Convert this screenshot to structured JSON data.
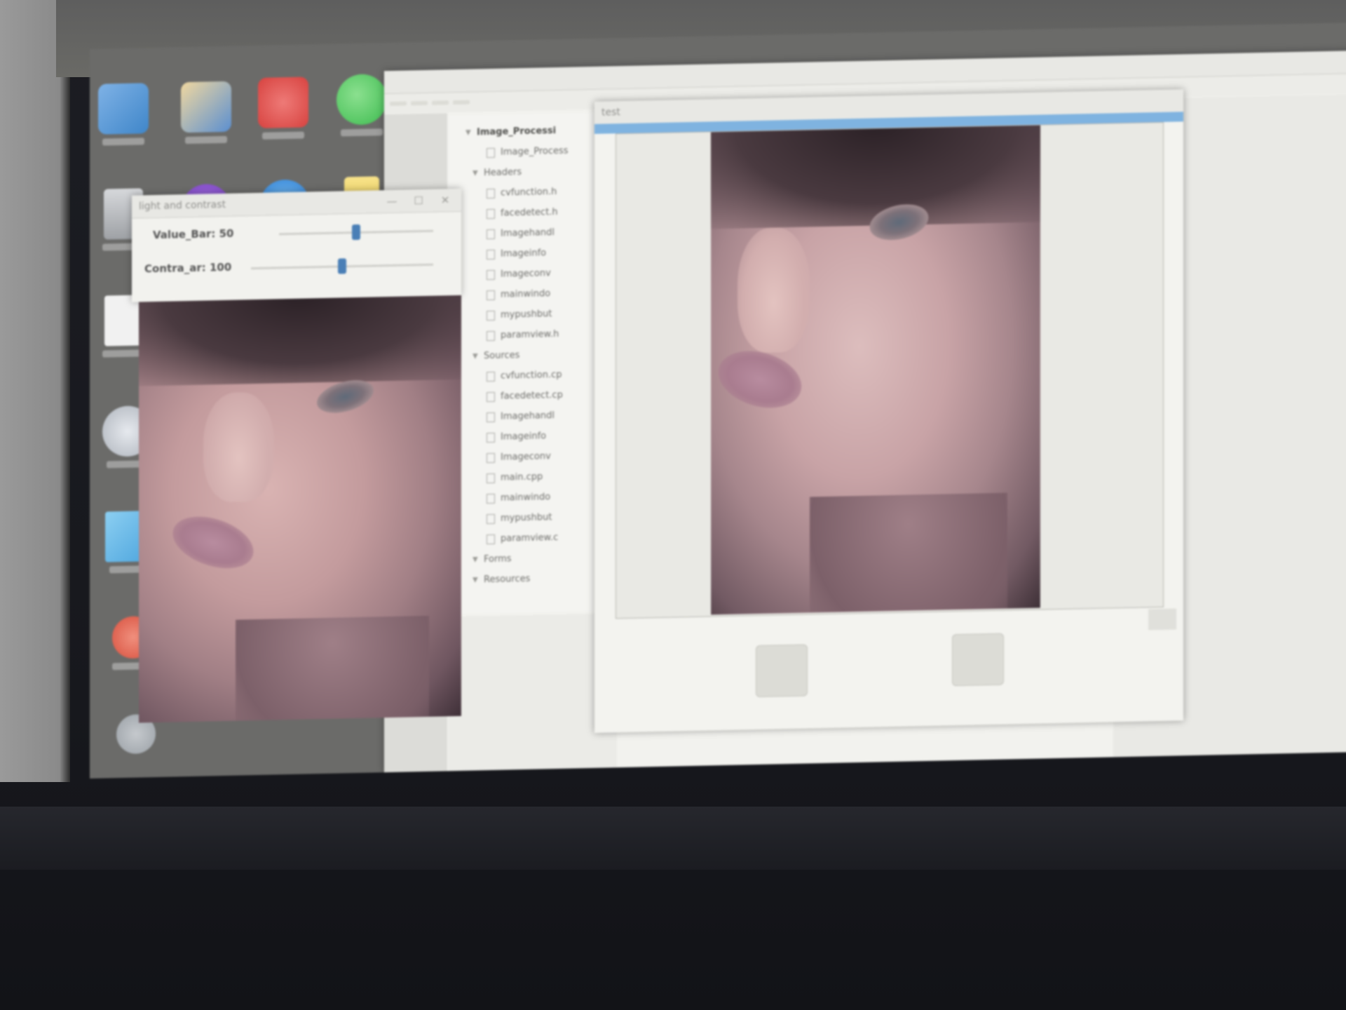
{
  "desktop": {
    "icons": [
      {
        "name": "computer",
        "label": "",
        "color": "#3f86c9"
      },
      {
        "name": "app-folder",
        "label": "",
        "color": "#5b8fd0"
      },
      {
        "name": "music",
        "label": "",
        "color": "#d7423f"
      },
      {
        "name": "wechat",
        "label": "",
        "color": "#3dbb4f"
      },
      {
        "name": "recycle-bin",
        "label": "",
        "color": "#b9bbbe"
      },
      {
        "name": "app-purple",
        "label": "",
        "color": "#7b3fc4"
      },
      {
        "name": "ie",
        "label": "",
        "color": "#2f7fd4"
      },
      {
        "name": "notes",
        "label": "",
        "color": "#e8c842"
      },
      {
        "name": "document",
        "label": "",
        "color": "#eeeeee"
      },
      {
        "name": "steam",
        "label": "",
        "color": "#cfd3d9"
      },
      {
        "name": "control-panel",
        "label": "",
        "color": "#4aa3dc"
      },
      {
        "name": "app-red",
        "label": "",
        "color": "#d8503e"
      },
      {
        "name": "app-bottom",
        "label": "",
        "color": "#9aa0a6"
      }
    ]
  },
  "ide": {
    "title": "",
    "menus": [
      "",
      "",
      "",
      ""
    ],
    "project_tree": {
      "root": "Image_Processi",
      "items": [
        {
          "text": "Image_Process",
          "kind": "file"
        },
        {
          "text": "Headers",
          "kind": "folder"
        },
        {
          "text": "cvfunction.h",
          "kind": "file"
        },
        {
          "text": "facedetect.h",
          "kind": "file"
        },
        {
          "text": "Imagehandl",
          "kind": "file"
        },
        {
          "text": "Imageinfo",
          "kind": "file"
        },
        {
          "text": "Imageconv",
          "kind": "file"
        },
        {
          "text": "mainwindo",
          "kind": "file"
        },
        {
          "text": "mypushbut",
          "kind": "file"
        },
        {
          "text": "paramview.h",
          "kind": "file"
        },
        {
          "text": "Sources",
          "kind": "folder"
        },
        {
          "text": "cvfunction.cp",
          "kind": "file"
        },
        {
          "text": "facedetect.cp",
          "kind": "file"
        },
        {
          "text": "Imagehandl",
          "kind": "file"
        },
        {
          "text": "Imageinfo",
          "kind": "file"
        },
        {
          "text": "Imageconv",
          "kind": "file"
        },
        {
          "text": "main.cpp",
          "kind": "file"
        },
        {
          "text": "mainwindo",
          "kind": "file"
        },
        {
          "text": "mypushbut",
          "kind": "file"
        },
        {
          "text": "paramview.c",
          "kind": "file"
        },
        {
          "text": "Forms",
          "kind": "folder"
        },
        {
          "text": "Resources",
          "kind": "folder"
        }
      ]
    }
  },
  "light_dialog": {
    "title": "light and contrast",
    "value_bar_label": "Value_Bar: 50",
    "contrast_bar_label": "Contra_ar: 100",
    "value_level": 0.5,
    "contrast_level": 0.5,
    "accent": "#4a7fb6"
  },
  "preview_window": {
    "title": "test",
    "accent": "#7fb3e0",
    "zoom_in_label": "",
    "zoom_out_label": "",
    "side_label": ""
  },
  "controls": {
    "minimize": "—",
    "maximize": "☐",
    "close": "✕"
  }
}
